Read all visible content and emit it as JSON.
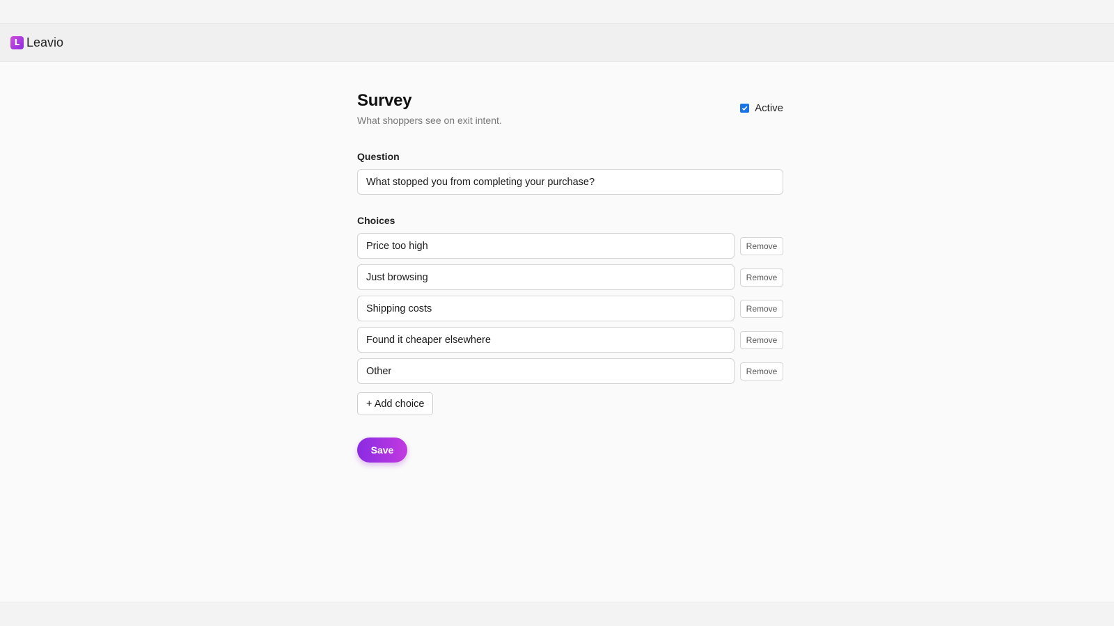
{
  "app": {
    "brand_name": "Leavio",
    "logo_letter": "L",
    "brand_colors": [
      "#d04fd8",
      "#8a2be2"
    ]
  },
  "page": {
    "title": "Survey",
    "subtitle": "What shoppers see on exit intent.",
    "active_label": "Active",
    "active_checked": true
  },
  "question": {
    "label": "Question",
    "value": "What stopped you from completing your purchase?"
  },
  "choices": {
    "label": "Choices",
    "remove_label": "Remove",
    "items": [
      "Price too high",
      "Just browsing",
      "Shipping costs",
      "Found it cheaper elsewhere",
      "Other"
    ],
    "add_label": "+ Add choice"
  },
  "actions": {
    "save_label": "Save",
    "accent_color": "#8a2be2"
  }
}
